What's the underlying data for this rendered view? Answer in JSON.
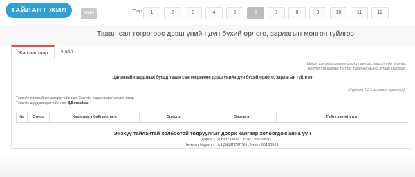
{
  "header": {
    "year_title": "ТАЙЛАНТ ЖИЛ",
    "year": "2015",
    "month_label": "Сар :",
    "months": [
      "1",
      "2",
      "3",
      "4",
      "5",
      "6",
      "7",
      "8",
      "9",
      "10",
      "11",
      "12"
    ],
    "active_month": "6"
  },
  "page": {
    "title": "Таван сая төгрөгөөс дээш үнийн дүн бүхий орлого, зарлагын мөнгөн гүйлгээ"
  },
  "tabs": [
    {
      "label": "Жагсаалтаар",
      "active": true
    },
    {
      "label": "Файл",
      "active": false
    }
  ],
  "report": {
    "note_line1": "Шилэн дансны цахим хуудаснд тавигдах мэдээллийн агуулга,",
    "note_line2": "нийтлэг стандартыг тогтоох тухай журмын 5 дугаар хавсралт.",
    "heading": "Цалингийн зардлаас бусад таван сая төгрөгөөс дээш үнийн дүн бүхий орлого, зарлагын гүйлгээ",
    "appendix": "(Хүснэгт-6.2.5 заавтын хэрэгжил)",
    "meta_line1": "Төсвийн ерөнхийлөн захирагчийн нэр: Засгийн газрын хэрэг эрхлэх газар",
    "meta_line2_label": "Төсвийн шууд захирагчийн нэр:",
    "meta_line2_value": "Д.Батсайхан"
  },
  "table": {
    "headers": [
      "№",
      "Огноо",
      "Харилцагч байгууллага",
      "Орлого",
      "Зарлага",
      "Гүйлгээний утга"
    ]
  },
  "footer": {
    "question": "Энэхүү тайлантай холбоотой тодруулгыг доорх хаягаар холбогдож авна уу !",
    "contact1_label": "Дарга :",
    "contact1_value": "Д.Батсайхан , Утас : 99190503",
    "contact2_label": "Нягтлан бодогч :",
    "contact2_value": "А.ЦЭЦЭГСҮРЭН , Утас : 99190503"
  },
  "colors": {
    "accent": "#2f9fd8",
    "tab_active_border": "#d9534f",
    "active_month": "#bdbdbd"
  }
}
